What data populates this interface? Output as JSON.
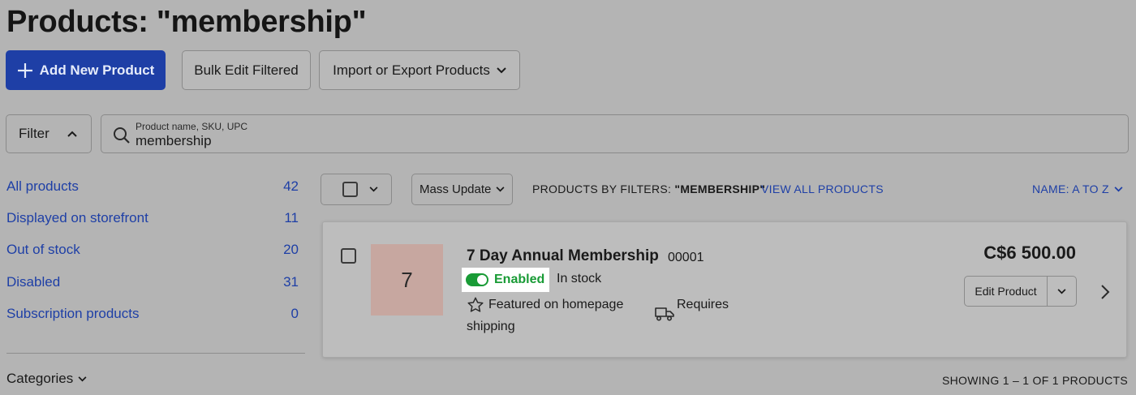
{
  "page": {
    "title": "Products: \"membership\""
  },
  "toolbar": {
    "add_label": "Add New Product",
    "bulk_label": "Bulk Edit Filtered",
    "import_label": "Import or Export Products"
  },
  "filter": {
    "label": "Filter"
  },
  "search": {
    "label": "Product name, SKU, UPC",
    "value": "membership"
  },
  "sidebar": {
    "items": [
      {
        "label": "All products",
        "count": "42"
      },
      {
        "label": "Displayed on storefront",
        "count": "11"
      },
      {
        "label": "Out of stock",
        "count": "20"
      },
      {
        "label": "Disabled",
        "count": "31"
      },
      {
        "label": "Subscription products",
        "count": "0"
      }
    ],
    "categories_label": "Categories"
  },
  "list_header": {
    "mass_update_label": "Mass Update",
    "filters_prefix": "PRODUCTS BY FILTERS:",
    "filters_query": "\"MEMBERSHIP\"",
    "view_all_label": "VIEW ALL PRODUCTS",
    "sort_label": "NAME: A TO Z"
  },
  "product": {
    "thumb_text": "7",
    "name": "7 Day Annual Membership",
    "sku": "00001",
    "status": "Enabled",
    "stock": "In stock",
    "featured": "Featured on homepage",
    "requires": "Requires",
    "shipping": "shipping",
    "price": "C$6 500.00",
    "edit_label": "Edit Product"
  },
  "footer": {
    "showing": "SHOWING 1 – 1 OF 1 PRODUCTS"
  },
  "colors": {
    "primary": "#1e3fa6",
    "enabled": "#199b36",
    "background": "#b4b4b4"
  }
}
